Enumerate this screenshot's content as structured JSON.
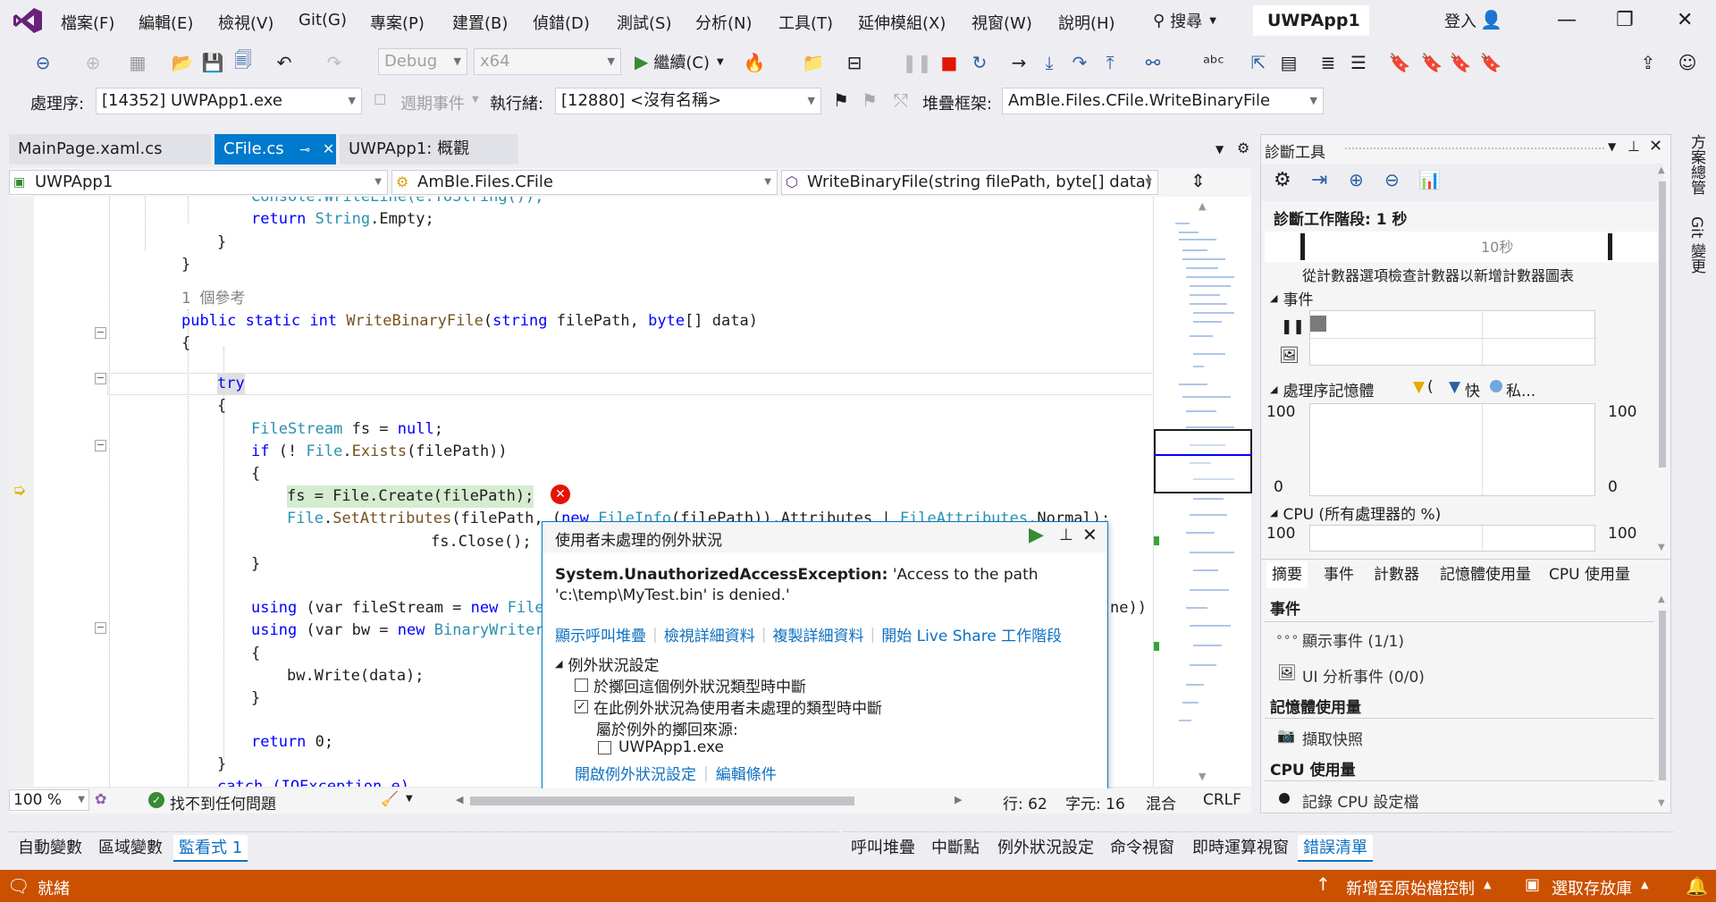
{
  "menu": {
    "items": [
      "檔案(F)",
      "編輯(E)",
      "檢視(V)",
      "Git(G)",
      "專案(P)",
      "建置(B)",
      "偵錯(D)",
      "測試(S)",
      "分析(N)",
      "工具(T)",
      "延伸模組(X)",
      "視窗(W)",
      "說明(H)"
    ],
    "search_label": "搜尋",
    "app_title": "UWPApp1",
    "login_label": "登入"
  },
  "toolbar": {
    "config": "Debug",
    "platform": "x64",
    "continue_label": "繼續(C)"
  },
  "debug_bar": {
    "process_label": "處理序:",
    "process_value": "[14352] UWPApp1.exe",
    "lifecycle_label": "週期事件",
    "thread_label": "執行緒:",
    "thread_value": "[12880] <沒有名稱>",
    "stackframe_label": "堆疊框架:",
    "stackframe_value": "AmBle.Files.CFile.WriteBinaryFile"
  },
  "doc_tabs": [
    {
      "label": "MainPage.xaml.cs"
    },
    {
      "label": "CFile.cs"
    },
    {
      "label": "UWPApp1: 概觀"
    }
  ],
  "navbar": {
    "project": "UWPApp1",
    "class": "AmBle.Files.CFile",
    "method": "WriteBinaryFile(string filePath, byte[] data)"
  },
  "code": {
    "l0": "Console.WriteLine(e.ToString());",
    "l1_kw": "return",
    "l1_ty": "String",
    "l1_rest": ".Empty;",
    "l2": "}",
    "l3": "}",
    "refs": "1 個參考",
    "sig_kw1": "public",
    "sig_kw2": "static",
    "sig_kw3": "int",
    "sig_name": "WriteBinaryFile",
    "sig_rest1": "(",
    "sig_kw4": "string",
    "sig_rest2": " filePath, ",
    "sig_kw5": "byte",
    "sig_rest3": "[] data)",
    "brace_open": "{",
    "try_kw": "try",
    "brace_open2": "{",
    "fs_ty": "FileStream",
    "fs_rest": " fs = ",
    "fs_null": "null",
    "fs_end": ";",
    "if_kw": "if",
    "if_rest1": " (! ",
    "if_ty": "File",
    "if_rest2": ".",
    "if_mt": "Exists",
    "if_rest3": "(filePath))",
    "brace_open3": "{",
    "create_line": "fs = File.Create(filePath);",
    "setattr_ty": "File",
    "setattr_rest1": ".",
    "setattr_mt": "SetAttributes",
    "setattr_rest2": "(filePath, (",
    "setattr_kw": "new",
    "setattr_ty2": "FileInfo",
    "setattr_rest3": "(filePath)).Attributes | ",
    "setattr_ty3": "FileAttributes",
    "setattr_rest4": ".Normal);",
    "close_line": "fs.Close();",
    "brace_close3": "}",
    "using1_kw": "using",
    "using1_rest": " (var fileStream = ",
    "using1_kw2": "new",
    "using1_ty": "FileS",
    "using1_tail": "ne))",
    "using2_kw": "using",
    "using2_rest": " (var bw = ",
    "using2_kw2": "new",
    "using2_ty": "BinaryWriter(",
    "brace_open4": "{",
    "write_line": "bw.Write(data);",
    "brace_close4": "}",
    "return_kw": "return",
    "return_rest": " 0;",
    "brace_close2": "}",
    "catch_line": "catch (IOException e)"
  },
  "exception": {
    "title": "使用者未處理的例外狀況",
    "type": "System.UnauthorizedAccessException:",
    "message": " 'Access to the path 'c:\\temp\\MyTest.bin' is denied.'",
    "links": [
      "顯示呼叫堆疊",
      "檢視詳細資料",
      "複製詳細資料",
      "開始 Live Share 工作階段"
    ],
    "settings_label": "例外狀況設定",
    "cb1_label": "於擲回這個例外狀況類型時中斷",
    "cb1_checked": false,
    "cb2_label": "在此例外狀況為使用者未處理的類型時中斷",
    "cb2_checked": true,
    "source_label": "屬於例外的擲回來源:",
    "cb3_label": "UWPApp1.exe",
    "cb3_checked": false,
    "footer_links": [
      "開啟例外狀況設定",
      "編輯條件"
    ]
  },
  "editor_status": {
    "zoom": "100 %",
    "issues": "找不到任何問題",
    "line": "行: 62",
    "col": "字元: 16",
    "mixed": "混合",
    "eol": "CRLF"
  },
  "diagnostics": {
    "title": "診斷工具",
    "session": "診斷工作階段: 1 秒",
    "tick_label": "10秒",
    "hint": "從計數器選項檢查計數器以新增計數器圖表",
    "events_section": "事件",
    "mem_section": "處理序記憶體",
    "mem_legend1": "(",
    "mem_legend2": "快",
    "mem_legend3": "私...",
    "mem_top_left": "100",
    "mem_top_right": "100",
    "mem_bottom_left": "0",
    "mem_bottom_right": "0",
    "cpu_section": "CPU (所有處理器的 %)",
    "cpu_top_left": "100",
    "cpu_top_right": "100",
    "tabs": [
      "摘要",
      "事件",
      "計數器",
      "記憶體使用量",
      "CPU 使用量"
    ],
    "summary_events": "事件",
    "show_events": "顯示事件 (1/1)",
    "ui_events": "UI 分析事件 (0/0)",
    "mem_usage": "記憶體使用量",
    "snapshot": "擷取快照",
    "cpu_usage": "CPU 使用量",
    "record_cpu": "記錄 CPU 設定檔"
  },
  "side_tabs": [
    "方案總管",
    "Git 變更"
  ],
  "bottom_tabs_left": [
    "自動變數",
    "區域變數",
    "監看式 1"
  ],
  "bottom_tabs_right": [
    "呼叫堆疊",
    "中斷點",
    "例外狀況設定",
    "命令視窗",
    "即時運算視窗",
    "錯誤清單"
  ],
  "statusbar": {
    "ready": "就緒",
    "add_source": "新增至原始檔控制",
    "select_repo": "選取存放庫"
  },
  "colors": {
    "accent": "#007acc",
    "statusbar": "#ca5100",
    "error": "#e51400"
  }
}
